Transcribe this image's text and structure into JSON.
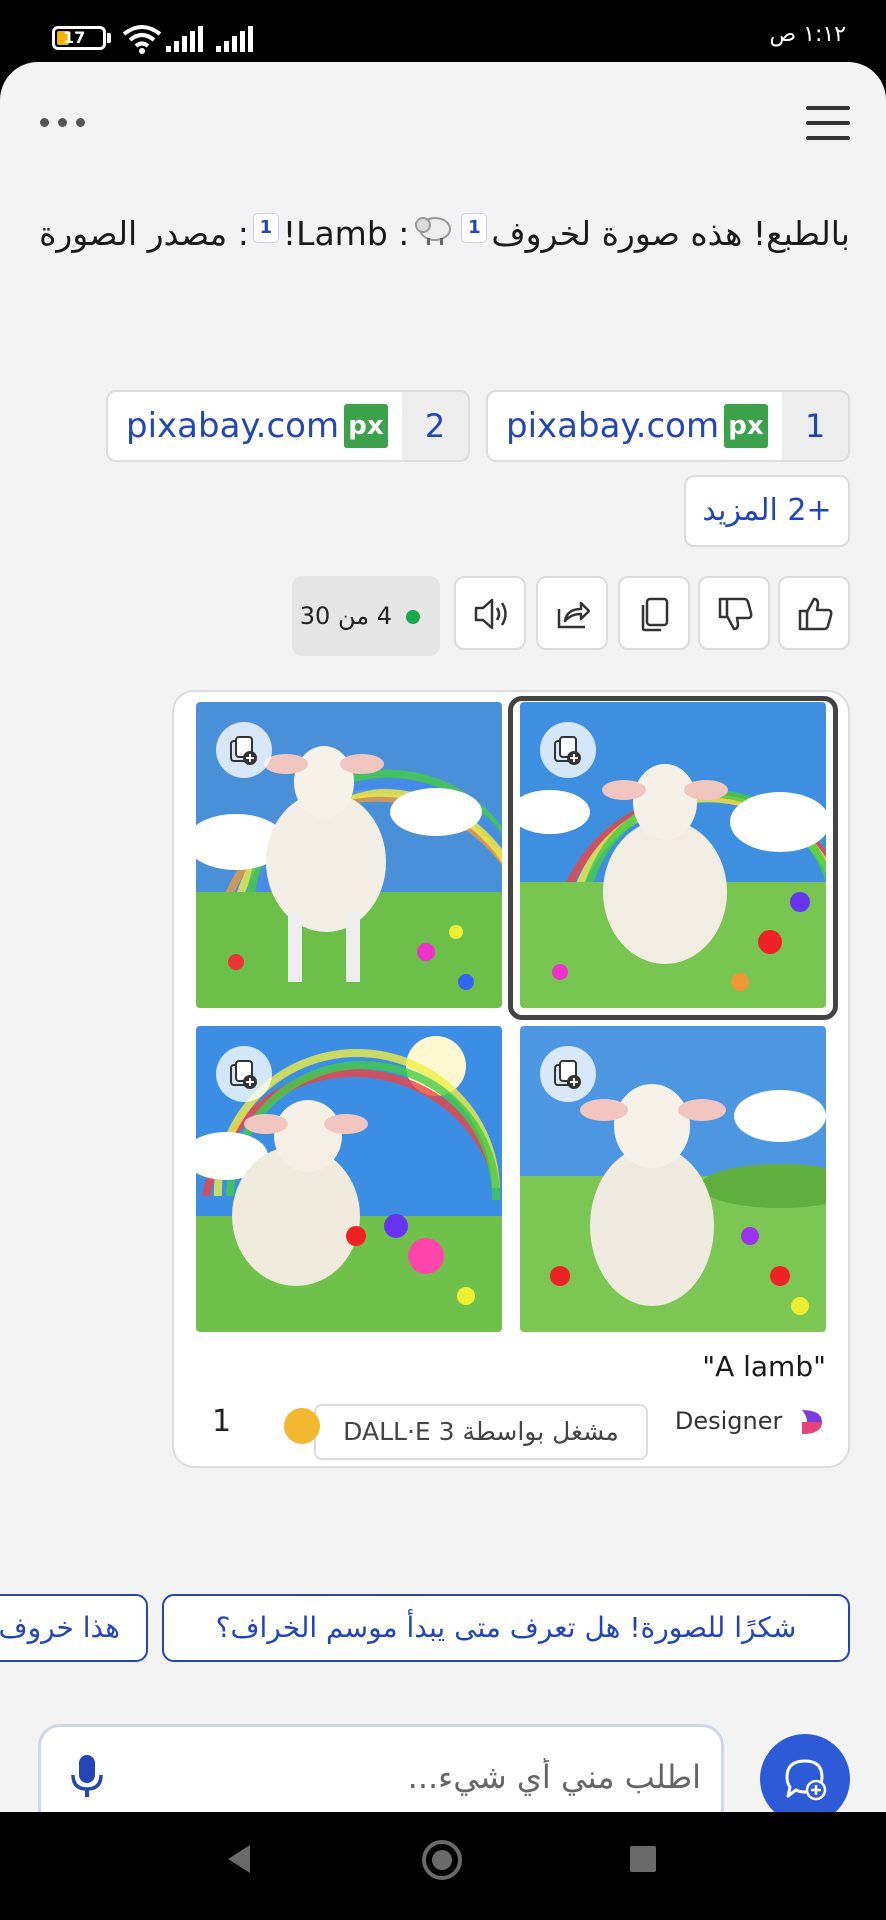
{
  "status_bar": {
    "time": "١:١٢ ص",
    "battery": "17"
  },
  "message": {
    "text_before": "بالطبع! هذه صورة لخروف",
    "cite1": "1",
    "text_mid": ": Lamb!",
    "cite2": "1",
    "text_after": ": مصدر الصورة"
  },
  "sources": [
    {
      "num": "1",
      "label": "pixabay.com",
      "logo": "px"
    },
    {
      "num": "2",
      "label": "pixabay.com",
      "logo": "px"
    }
  ],
  "more_sources": "+2 المزيد",
  "counter": "4 من 30",
  "image_card": {
    "prompt": "\"A lamb\"",
    "powered_by": "مشغل بواسطة DALL·E 3",
    "designer": "Designer",
    "boosts": "1"
  },
  "suggestions": [
    "شكرًا للصورة! هل تعرف متى يبدأ موسم الخراف؟",
    "هذا خروف"
  ],
  "input": {
    "placeholder": "اطلب مني أي شيء..."
  },
  "colors": {
    "accent": "#2345b5",
    "fab": "#2d5bd8"
  }
}
